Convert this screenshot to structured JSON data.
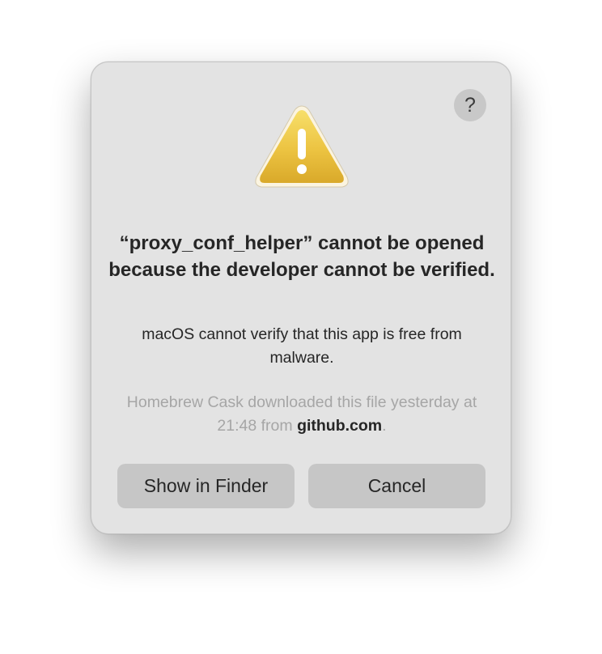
{
  "dialog": {
    "help_label": "?",
    "icon": "warning-triangle-icon",
    "title": "“proxy_conf_helper” cannot be opened because the developer cannot be verified.",
    "message": "macOS cannot verify that this app is free from malware.",
    "source_prefix": "Homebrew Cask downloaded this file yesterday at 21:48 from ",
    "source_domain": "github.com",
    "source_suffix": ".",
    "buttons": {
      "show_in_finder": "Show in Finder",
      "cancel": "Cancel"
    }
  },
  "colors": {
    "dialog_background": "#e3e3e3",
    "button_background": "#c6c6c6",
    "warning_yellow": "#e5b93a",
    "secondary_text": "#a6a6a6"
  }
}
